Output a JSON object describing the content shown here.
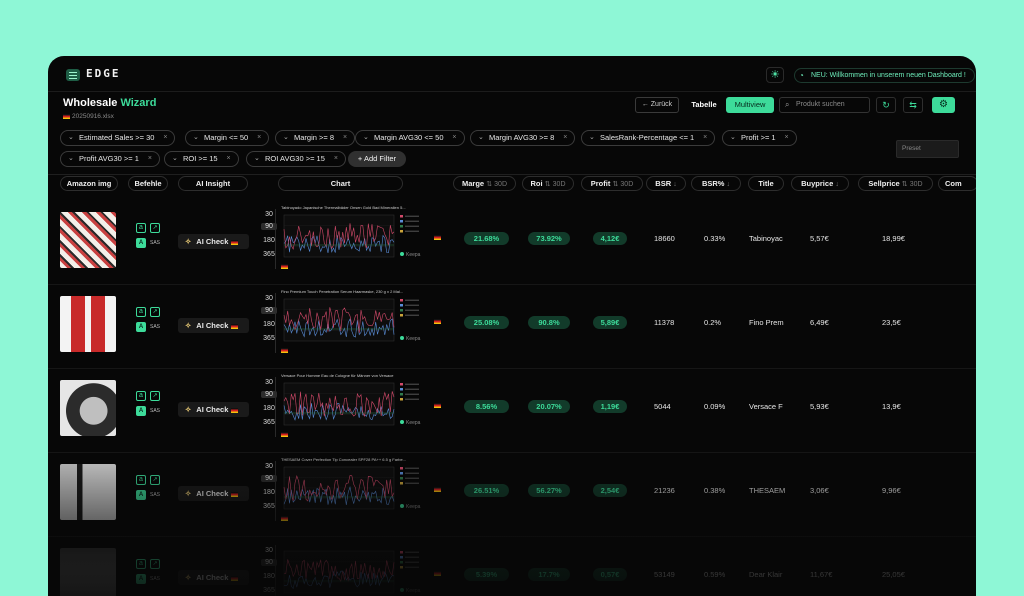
{
  "app": {
    "logo": "EDGE",
    "announcement": "NEU: Willkommen in unserem neuen Dashboard !"
  },
  "page": {
    "title_main": "Wholesale",
    "title_accent": "Wizard",
    "file": "20250916.xlsx"
  },
  "toolbar": {
    "back": "← Zurück",
    "view_table": "Tabelle",
    "view_multi": "Multiview",
    "search_placeholder": "Produkt suchen",
    "preset_placeholder": "Preset"
  },
  "filters": [
    "Estimated Sales >= 30",
    "Margin <= 50",
    "Margin >= 8",
    "Margin AVG30 <= 50",
    "Margin AVG30 >= 8",
    "SalesRank-Percentage <= 1",
    "Profit >= 1",
    "Profit AVG30 >= 1",
    "ROI >= 15",
    "ROI AVG30 >= 15"
  ],
  "add_filter": "+ Add Filter",
  "columns": {
    "amazon_img": "Amazon img",
    "befehle": "Befehle",
    "ai_insight": "AI Insight",
    "chart": "Chart",
    "marge": "Marge",
    "roi": "Roi",
    "profit": "Profit",
    "bsr": "BSR",
    "bsr_pct": "BSR%",
    "title": "Title",
    "buyprice": "Buyprice",
    "sellprice": "Sellprice",
    "com": "Com",
    "avg_suffix": "30D"
  },
  "ai_check_label": "AI Check",
  "sas_label": "SAS",
  "chart_ranges": [
    "30",
    "90",
    "180",
    "365"
  ],
  "keepa_label": "Keepa",
  "rows": [
    {
      "chart_title": "Tabinoyado Japanische Thermalbäder Onsen Gold Bad Mineralien 5...",
      "marge": "21.68%",
      "roi": "73.92%",
      "profit": "4,12€",
      "bsr": "18660",
      "bsr_pct": "0.33%",
      "title": "Tabinoyac",
      "buyprice": "5,57€",
      "sellprice": "18,99€"
    },
    {
      "chart_title": "Fino Premium Touch Penetration Serum Haarmaske, 230 g x 2 Mal...",
      "marge": "25.08%",
      "roi": "90.8%",
      "profit": "5,89€",
      "bsr": "11378",
      "bsr_pct": "0.2%",
      "title": "Fino Prem",
      "buyprice": "6,49€",
      "sellprice": "23,5€"
    },
    {
      "chart_title": "Versace Pour Homme Eau de Cologne für Männer von Versace",
      "marge": "8.56%",
      "roi": "20.07%",
      "profit": "1,19€",
      "bsr": "5044",
      "bsr_pct": "0.09%",
      "title": "Versace F",
      "buyprice": "5,93€",
      "sellprice": "13,9€"
    },
    {
      "chart_title": "THESAEM Cover Perfection Tip Concealer SPF28 PA++ 6.5 g Farbe...",
      "marge": "26.51%",
      "roi": "56.27%",
      "profit": "2,54€",
      "bsr": "21236",
      "bsr_pct": "0.38%",
      "title": "THESAEM",
      "buyprice": "3,06€",
      "sellprice": "9,96€"
    },
    {
      "chart_title": "",
      "marge": "5.39%",
      "roi": "17.7%",
      "profit": "0,57€",
      "bsr": "53149",
      "bsr_pct": "0.59%",
      "title": "Dear Klair",
      "buyprice": "11,67€",
      "sellprice": "25,05€"
    }
  ],
  "colors": {
    "accent": "#3ddb9a",
    "background": "#070707",
    "frame": "#8ef7d6"
  },
  "icons": [
    "menu-icon",
    "sun-icon",
    "bell-icon",
    "search-icon",
    "refresh-icon",
    "sliders-icon",
    "gear-icon",
    "amazon-icon",
    "external-link-icon",
    "seller-amp-icon",
    "sparkle-icon",
    "de-flag-icon"
  ]
}
